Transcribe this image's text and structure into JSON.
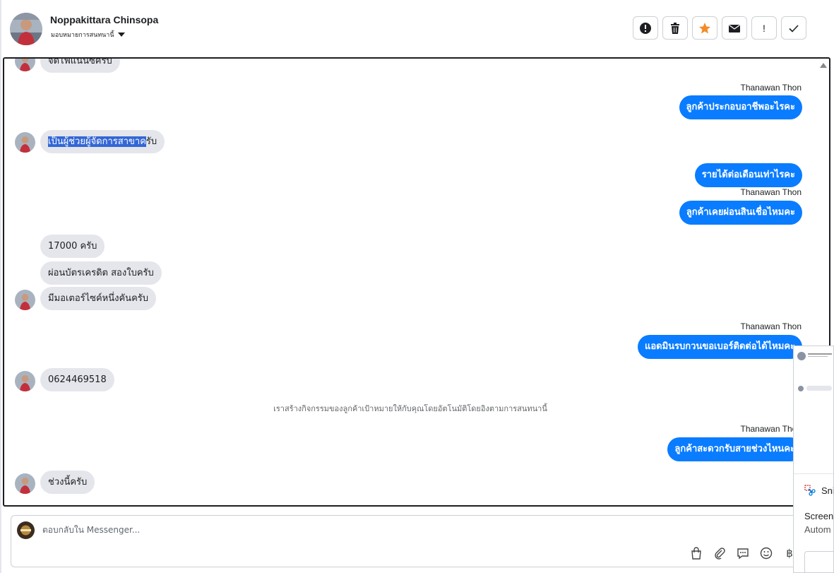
{
  "header": {
    "contact_name": "Noppakittara Chinsopa",
    "assign_label": "มอบหมายการสนทนานี้",
    "toolbar": {
      "spam_icon": "exclamation-circle-icon",
      "delete_icon": "trash-icon",
      "star_icon": "star-icon",
      "unread_icon": "envelope-icon",
      "important_label": "!",
      "done_label": "✓"
    }
  },
  "messages": [
    {
      "dir": "in",
      "text": "จัดไฟแนนซ์ครับ",
      "avatar": true
    },
    {
      "dir": "out",
      "sender": "Thanawan Thon",
      "text": "ลูกค้าประกอบอาชีพอะไรคะ"
    },
    {
      "dir": "in",
      "text_highlighted": "เป็นผู้ช่วยผู้จัดการสาขาค",
      "text_rest": "รับ",
      "avatar": true
    },
    {
      "dir": "out",
      "text": "รายได้ต่อเดือนเท่าไรคะ"
    },
    {
      "dir": "out",
      "sender": "Thanawan Thon",
      "text": "ลูกค้าเคยผ่อนสินเชื่อไหมคะ"
    },
    {
      "dir": "in",
      "text": "17000 ครับ"
    },
    {
      "dir": "in",
      "text": "ผ่อนบัตรเครดิต สองใบครับ"
    },
    {
      "dir": "in",
      "text": "มีมอเตอร์ไซค์หนึ่งคันครับ",
      "avatar": true
    },
    {
      "dir": "out",
      "sender": "Thanawan Thon",
      "text": "แอดมินรบกวนขอเบอร์ติดต่อได้ไหมคะ"
    },
    {
      "dir": "in",
      "text": "0624469518",
      "avatar": true
    },
    {
      "dir": "system",
      "text": "เราสร้างกิจกรรมของลูกค้าเป้าหมายให้กับคุณโดยอัตโนมัติโดยอิงตามการสนทนานี้"
    },
    {
      "dir": "out",
      "sender": "Thanawan Thon",
      "text": "ลูกค้าสะดวกรับสายช่วงไหนคะ"
    },
    {
      "dir": "in",
      "text": "ช่วงนี้ครับ",
      "avatar": true
    }
  ],
  "composer": {
    "placeholder": "ตอบกลับใน Messenger...",
    "icons": [
      "shopping-bag-icon",
      "paperclip-icon",
      "speech-bubble-icon",
      "smiley-icon",
      "baht-icon"
    ],
    "baht_symbol": "฿"
  },
  "overlay": {
    "snip_label": "Snip",
    "line1": "Screen",
    "line2": "Autom"
  },
  "colors": {
    "outgoing_bubble": "#0a7cff",
    "incoming_bubble": "#e4e6eb",
    "highlight": "#3367d6",
    "star": "#f28c28"
  }
}
